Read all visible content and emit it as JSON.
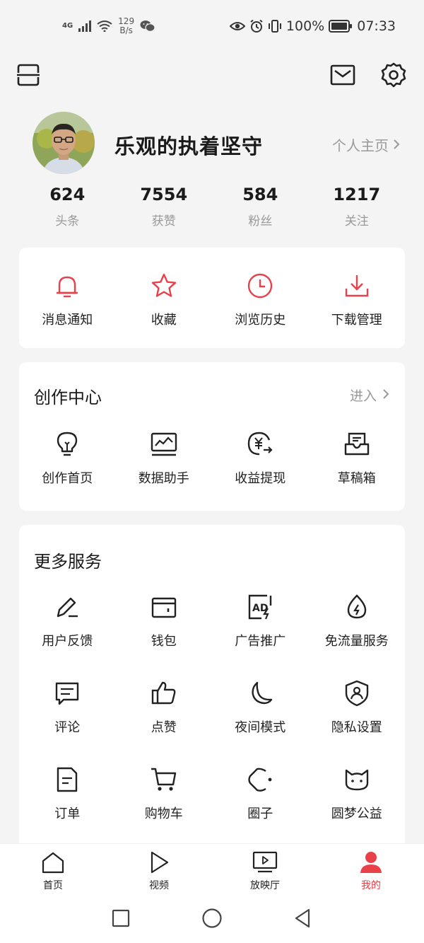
{
  "status_bar": {
    "network": "4G",
    "speed_value": "129",
    "speed_unit": "B/s",
    "battery": "100%",
    "time": "07:33"
  },
  "profile": {
    "username": "乐观的执着坚守",
    "homepage_label": "个人主页"
  },
  "stats": [
    {
      "value": "624",
      "label": "头条"
    },
    {
      "value": "7554",
      "label": "获赞"
    },
    {
      "value": "584",
      "label": "粉丝"
    },
    {
      "value": "1217",
      "label": "关注"
    }
  ],
  "quick_actions": [
    {
      "label": "消息通知",
      "icon": "bell-icon"
    },
    {
      "label": "收藏",
      "icon": "star-icon"
    },
    {
      "label": "浏览历史",
      "icon": "clock-icon"
    },
    {
      "label": "下载管理",
      "icon": "download-icon"
    }
  ],
  "creation_center": {
    "title": "创作中心",
    "enter_label": "进入",
    "items": [
      {
        "label": "创作首页",
        "icon": "lightbulb-icon"
      },
      {
        "label": "数据助手",
        "icon": "chart-monitor-icon"
      },
      {
        "label": "收益提现",
        "icon": "yuan-withdraw-icon"
      },
      {
        "label": "草稿箱",
        "icon": "draft-box-icon"
      }
    ]
  },
  "more_services": {
    "title": "更多服务",
    "rows": [
      [
        {
          "label": "用户反馈",
          "icon": "pen-feedback-icon"
        },
        {
          "label": "钱包",
          "icon": "wallet-icon"
        },
        {
          "label": "广告推广",
          "icon": "ad-icon"
        },
        {
          "label": "免流量服务",
          "icon": "water-drop-icon"
        }
      ],
      [
        {
          "label": "评论",
          "icon": "comment-icon"
        },
        {
          "label": "点赞",
          "icon": "thumbs-up-icon"
        },
        {
          "label": "夜间模式",
          "icon": "moon-icon"
        },
        {
          "label": "隐私设置",
          "icon": "privacy-shield-icon"
        }
      ],
      [
        {
          "label": "订单",
          "icon": "order-doc-icon"
        },
        {
          "label": "购物车",
          "icon": "cart-icon"
        },
        {
          "label": "圈子",
          "icon": "circle-group-icon"
        },
        {
          "label": "圆梦公益",
          "icon": "cat-face-icon"
        }
      ]
    ]
  },
  "tab_bar": [
    {
      "label": "首页",
      "icon": "home-icon",
      "active": false
    },
    {
      "label": "视频",
      "icon": "play-icon",
      "active": false
    },
    {
      "label": "放映厅",
      "icon": "tv-icon",
      "active": false
    },
    {
      "label": "我的",
      "icon": "person-icon",
      "active": true
    }
  ],
  "colors": {
    "accent": "#e8414a",
    "background": "#f4f4f4",
    "card": "#ffffff"
  }
}
